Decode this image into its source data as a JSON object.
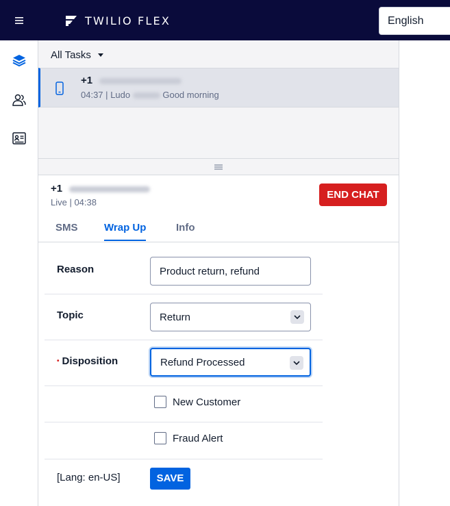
{
  "header": {
    "menu_icon": "hamburger-icon",
    "brand": "TWILIO FLEX",
    "language": "English",
    "colors": {
      "bar": "#0a0b3b"
    }
  },
  "sidenav": {
    "items": [
      {
        "icon": "layers-icon",
        "name": "Agent Desktop",
        "active": true
      },
      {
        "icon": "teams-icon",
        "name": "Teams",
        "active": false
      },
      {
        "icon": "directory-card-icon",
        "name": "Directory",
        "active": false
      }
    ]
  },
  "task_list": {
    "filter_label": "All Tasks",
    "tasks": [
      {
        "number": "+1",
        "time": "04:37",
        "separator": "|",
        "agent": "Ludo",
        "preview": "Good morning",
        "channel_icon": "mobile-phone-icon"
      }
    ]
  },
  "task_detail": {
    "number": "+1",
    "status": "Live | 04:38",
    "end_chat_label": "END CHAT",
    "tabs": [
      {
        "label": "SMS",
        "active": false
      },
      {
        "label": "Wrap Up",
        "active": true
      },
      {
        "label": "Info",
        "active": false
      }
    ],
    "form": {
      "reason_label": "Reason",
      "reason_value": "Product return, refund",
      "topic_label": "Topic",
      "topic_value": "Return",
      "disposition_label": "Disposition",
      "disposition_required_mark": "•",
      "disposition_value": "Refund Processed",
      "new_customer_label": "New Customer",
      "new_customer_checked": false,
      "fraud_alert_label": "Fraud Alert",
      "fraud_alert_checked": false
    },
    "lang_note": "[Lang: en-US]",
    "save_label": "SAVE",
    "colors": {
      "accent": "#0263e0",
      "danger": "#d61f1f"
    }
  }
}
